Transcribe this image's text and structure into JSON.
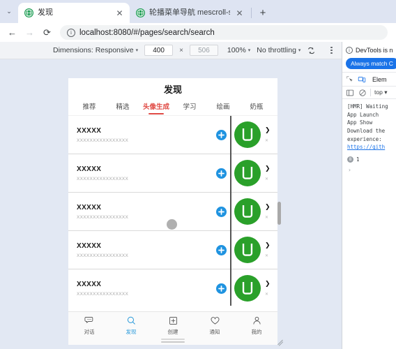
{
  "browser": {
    "tabs": [
      {
        "title": "发现",
        "active": true,
        "favicon": "globe-icon",
        "close_glyph": "✕"
      },
      {
        "title": "轮播菜单导航 mescroll-swipe",
        "active": false,
        "favicon": "globe-icon",
        "close_glyph": "✕"
      }
    ],
    "tab_list_chevron": "⌄",
    "new_tab_glyph": "+",
    "nav": {
      "back_glyph": "←",
      "forward_glyph": "→",
      "reload_glyph": "⟳"
    },
    "omnibox": {
      "info_glyph": "ⓘ",
      "url": "localhost:8080/#/pages/search/search"
    }
  },
  "device_toolbar": {
    "dimensions_label": "Dimensions: Responsive",
    "dimensions_caret": "▾",
    "width_value": "400",
    "separator": "×",
    "height_value": "506",
    "zoom_value": "100%",
    "zoom_caret": "▾",
    "throttling_label": "No throttling",
    "throttling_caret": "▾",
    "rotate_icon": "rotate-icon",
    "more_options_icon": "kebab-menu-icon"
  },
  "phone": {
    "header_title": "发现",
    "category_tabs": [
      {
        "label": "推荐",
        "active": false
      },
      {
        "label": "精选",
        "active": false
      },
      {
        "label": "头像生成",
        "active": true
      },
      {
        "label": "学习",
        "active": false
      },
      {
        "label": "绘画",
        "active": false
      },
      {
        "label": "奶瓶",
        "active": false
      }
    ],
    "accent_color": "#e04b45",
    "avatar_color": "#2aa02a",
    "plus_color": "#1f93e0",
    "rows": [
      {
        "title": "XXXXX",
        "subtitle": "XXXXXXXXXXXXXXXX",
        "chevron": "❯",
        "x_mark": "✕"
      },
      {
        "title": "XXXXX",
        "subtitle": "XXXXXXXXXXXXXXXX",
        "chevron": "❯",
        "x_mark": "✕"
      },
      {
        "title": "XXXXX",
        "subtitle": "XXXXXXXXXXXXXXXX",
        "chevron": "❯",
        "x_mark": "✕"
      },
      {
        "title": "XXXXX",
        "subtitle": "XXXXXXXXXXXXXXXX",
        "chevron": "❯",
        "x_mark": "✕"
      },
      {
        "title": "XXXXX",
        "subtitle": "XXXXXXXXXXXXXXXX",
        "chevron": "❯",
        "x_mark": "✕"
      }
    ],
    "tabbar": [
      {
        "label": "对话",
        "icon": "chat-bubble-icon",
        "active": false
      },
      {
        "label": "发现",
        "icon": "search-icon",
        "active": true
      },
      {
        "label": "创建",
        "icon": "plus-square-icon",
        "active": false
      },
      {
        "label": "通知",
        "icon": "heart-icon",
        "active": false
      },
      {
        "label": "我的",
        "icon": "person-icon",
        "active": false
      }
    ],
    "active_tab_color": "#2196d9"
  },
  "devtools": {
    "banner_text": "DevTools is n",
    "banner_button": "Always match C",
    "inspect_icon": "inspect-element-icon",
    "device_icon": "device-toolbar-icon",
    "panel_tab": "Elem",
    "sidebar_icon": "console-sidebar-icon",
    "clear_icon": "clear-console-icon",
    "context_label": "top",
    "context_caret": "▾",
    "console_lines": [
      "[HMR] Waiting",
      "App Launch",
      "App Show",
      "Download the",
      "experience:"
    ],
    "console_link": "https://gith",
    "error_badge": "8",
    "error_count": "1",
    "prompt": "›"
  }
}
